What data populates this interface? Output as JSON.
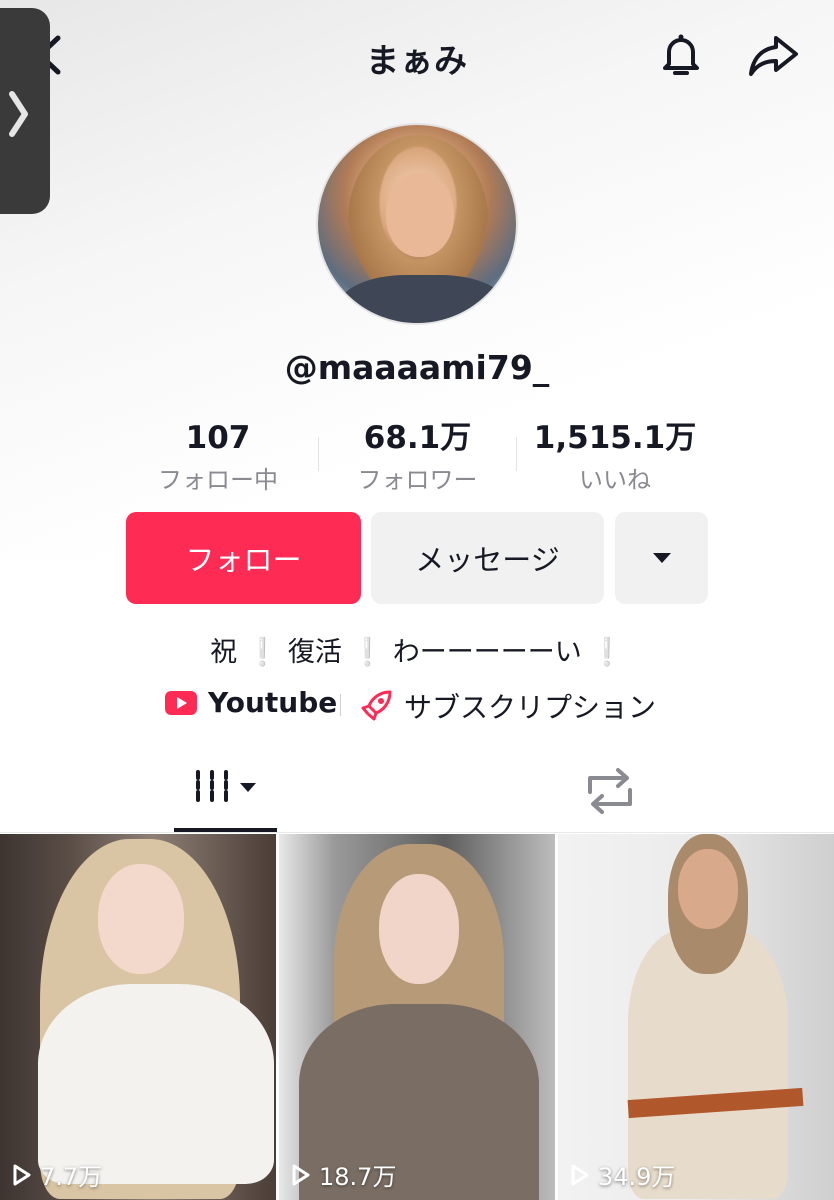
{
  "header": {
    "title": "まぁみ",
    "back_icon": "chevron-left-icon",
    "bell_icon": "bell-icon",
    "share_icon": "share-arrow-icon"
  },
  "profile": {
    "handle": "@maaaami79_",
    "stats": [
      {
        "value": "107",
        "label": "フォロー中"
      },
      {
        "value": "68.1万",
        "label": "フォロワー"
      },
      {
        "value": "1,515.1万",
        "label": "いいね"
      }
    ]
  },
  "actions": {
    "follow_label": "フォロー",
    "message_label": "メッセージ",
    "more_icon": "caret-down-icon",
    "accent_color": "#fe2c55"
  },
  "bio": {
    "part1": "祝",
    "part2": "復活",
    "part3": "わーーーーーい",
    "mark": "❕"
  },
  "links": {
    "youtube_label": "Youtube",
    "subscription_label": "サブスクリプション"
  },
  "tabs": {
    "videos_icon": "grid-bars-icon",
    "repost_icon": "repost-icon"
  },
  "videos": [
    {
      "views": "7.7万"
    },
    {
      "views": "18.7万"
    },
    {
      "views": "34.9万"
    }
  ]
}
